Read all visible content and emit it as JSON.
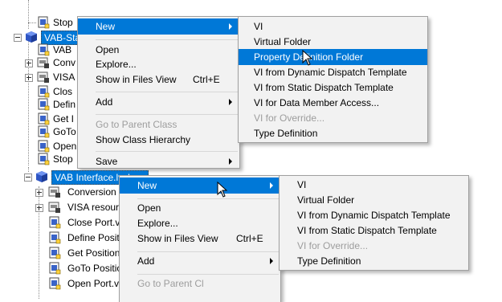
{
  "top_tree": {
    "items": [
      {
        "label": "Stop"
      },
      {
        "label": "VAB-Sta"
      },
      {
        "label": "VAB"
      },
      {
        "label": "Conv"
      },
      {
        "label": "VISA"
      },
      {
        "label": "Clos"
      },
      {
        "label": "Defin"
      },
      {
        "label": "Get I"
      },
      {
        "label": "GoTo"
      },
      {
        "label": "Open"
      },
      {
        "label": "Stop"
      }
    ]
  },
  "top_context_menu": {
    "items": [
      {
        "label": "New"
      },
      {
        "label": "Open"
      },
      {
        "label": "Explore..."
      },
      {
        "label": "Show in Files View",
        "shortcut": "Ctrl+E"
      },
      {
        "label": "Add"
      },
      {
        "label": "Go to Parent Class"
      },
      {
        "label": "Show Class Hierarchy"
      },
      {
        "label": "Save"
      }
    ]
  },
  "top_submenu": {
    "items": [
      {
        "label": "VI"
      },
      {
        "label": "Virtual Folder"
      },
      {
        "label": "Property Definition Folder"
      },
      {
        "label": "VI from Dynamic Dispatch Template"
      },
      {
        "label": "VI from Static Dispatch Template"
      },
      {
        "label": "VI for Data Member Access..."
      },
      {
        "label": "VI for Override..."
      },
      {
        "label": "Type Definition"
      }
    ]
  },
  "bottom_tree": {
    "items": [
      {
        "label": "VAB Interface.lvclass"
      },
      {
        "label": "Conversion I"
      },
      {
        "label": "VISA resourc"
      },
      {
        "label": "Close Port.vi"
      },
      {
        "label": "Define Positi"
      },
      {
        "label": "Get Position"
      },
      {
        "label": "GoTo Positio"
      },
      {
        "label": "Open Port.vi"
      }
    ]
  },
  "bottom_context_menu": {
    "items": [
      {
        "label": "New"
      },
      {
        "label": "Open"
      },
      {
        "label": "Explore..."
      },
      {
        "label": "Show in Files View",
        "shortcut": "Ctrl+E"
      },
      {
        "label": "Add"
      },
      {
        "label": "Go to Parent Cl"
      }
    ]
  },
  "bottom_submenu": {
    "items": [
      {
        "label": "VI"
      },
      {
        "label": "Virtual Folder"
      },
      {
        "label": "VI from Dynamic Dispatch Template"
      },
      {
        "label": "VI from Static Dispatch Template"
      },
      {
        "label": "VI for Override..."
      },
      {
        "label": "Type Definition"
      }
    ]
  },
  "colors": {
    "highlight": "#0078d7",
    "menu_bg": "#f2f2f2",
    "disabled_text": "#9d9d9d"
  }
}
